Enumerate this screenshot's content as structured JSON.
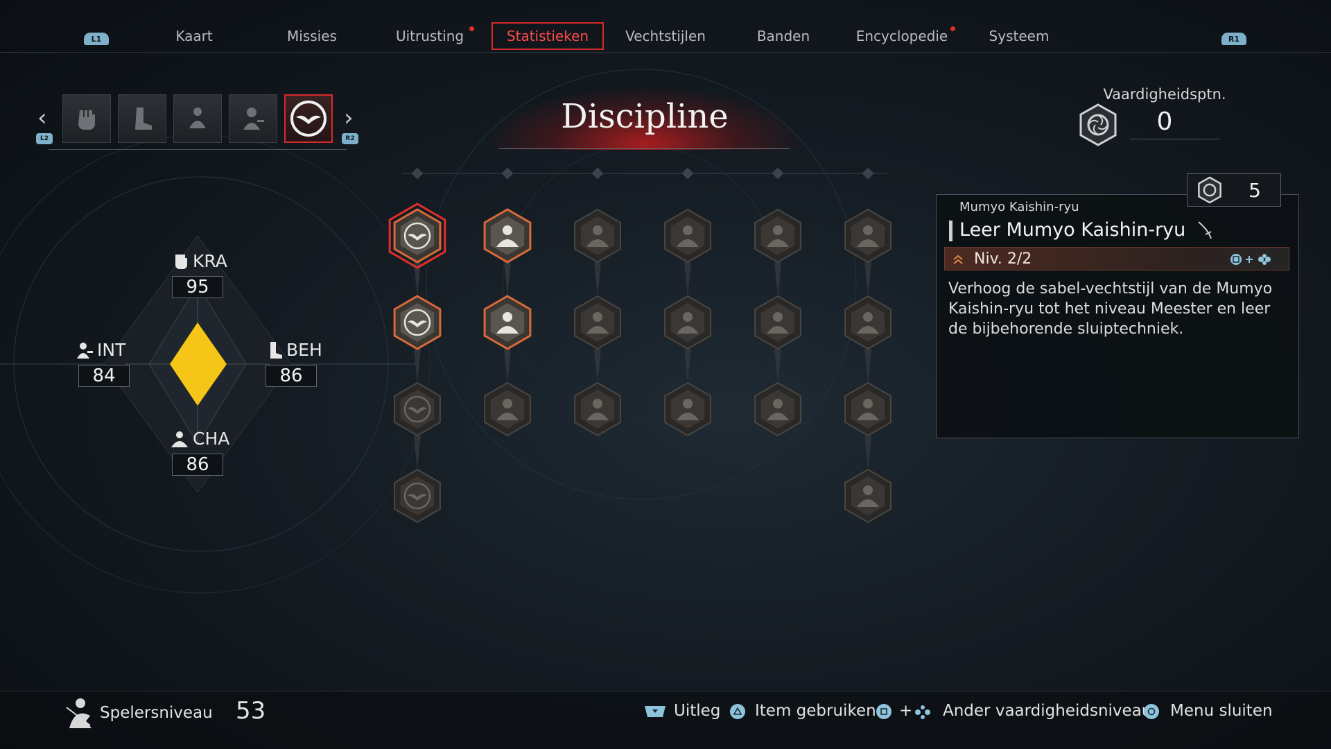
{
  "nav": {
    "left_shoulder": "L1",
    "right_shoulder": "R1",
    "tabs": [
      {
        "label": "Kaart",
        "notification": false,
        "active": false
      },
      {
        "label": "Missies",
        "notification": false,
        "active": false
      },
      {
        "label": "Uitrusting",
        "notification": true,
        "active": false
      },
      {
        "label": "Statistieken",
        "notification": false,
        "active": true
      },
      {
        "label": "Vechtstijlen",
        "notification": false,
        "active": false
      },
      {
        "label": "Banden",
        "notification": false,
        "active": false
      },
      {
        "label": "Encyclopedie",
        "notification": true,
        "active": false
      },
      {
        "label": "Systeem",
        "notification": false,
        "active": false
      }
    ]
  },
  "categories": {
    "prev_button": "L2",
    "next_button": "R2",
    "items": [
      "fist-icon",
      "boot-icon",
      "meditating-figure-icon",
      "scholar-icon",
      "bird-emblem-icon"
    ],
    "selected_index": 4
  },
  "title": "Discipline",
  "skill_points": {
    "label": "Vaardigheidsptn.",
    "value": "0"
  },
  "stats": {
    "kra": {
      "label": "KRA",
      "value": "95"
    },
    "int": {
      "label": "INT",
      "value": "84"
    },
    "beh": {
      "label": "BEH",
      "value": "86"
    },
    "cha": {
      "label": "CHA",
      "value": "86"
    }
  },
  "skill_tree": {
    "columns": [
      {
        "nodes": [
          "unlocked-bird",
          "unlocked-bird",
          "locked-bird",
          "locked-bird"
        ],
        "selected": 0
      },
      {
        "nodes": [
          "unlocked-figure",
          "unlocked-figure",
          "locked-figure"
        ]
      },
      {
        "nodes": [
          "locked-figure",
          "locked-figure",
          "locked-figure"
        ]
      },
      {
        "nodes": [
          "locked-figure",
          "locked-figure",
          "locked-figure"
        ]
      },
      {
        "nodes": [
          "locked-figure",
          "locked-figure",
          "locked-figure"
        ]
      },
      {
        "nodes": [
          "locked-figure",
          "locked-figure",
          "locked-figure",
          "locked-figure"
        ]
      }
    ]
  },
  "detail": {
    "cost": "5",
    "category": "Mumyo Kaishin-ryu",
    "title": "Leer Mumyo Kaishin-ryu",
    "level": "Niv. 2/2",
    "description": "Verhoog de sabel-vechtstijl van de Mumyo Kaishin-ryu tot het niveau Meester en leer de bijbehorende sluiptechniek."
  },
  "footer": {
    "player_level_label": "Spelersniveau",
    "player_level_value": "53",
    "actions": [
      {
        "label": "Uitleg",
        "button": "touchpad"
      },
      {
        "label": "Item gebruiken",
        "button": "triangle"
      },
      {
        "label": "Ander vaardigheidsniveau",
        "button": "square-plus-dpad"
      },
      {
        "label": "Menu sluiten",
        "button": "circle"
      }
    ],
    "plus": "+"
  },
  "colors": {
    "accent_red": "#d62a2a",
    "stat_gold": "#f5c518",
    "button_blue": "#8ec3dc"
  }
}
